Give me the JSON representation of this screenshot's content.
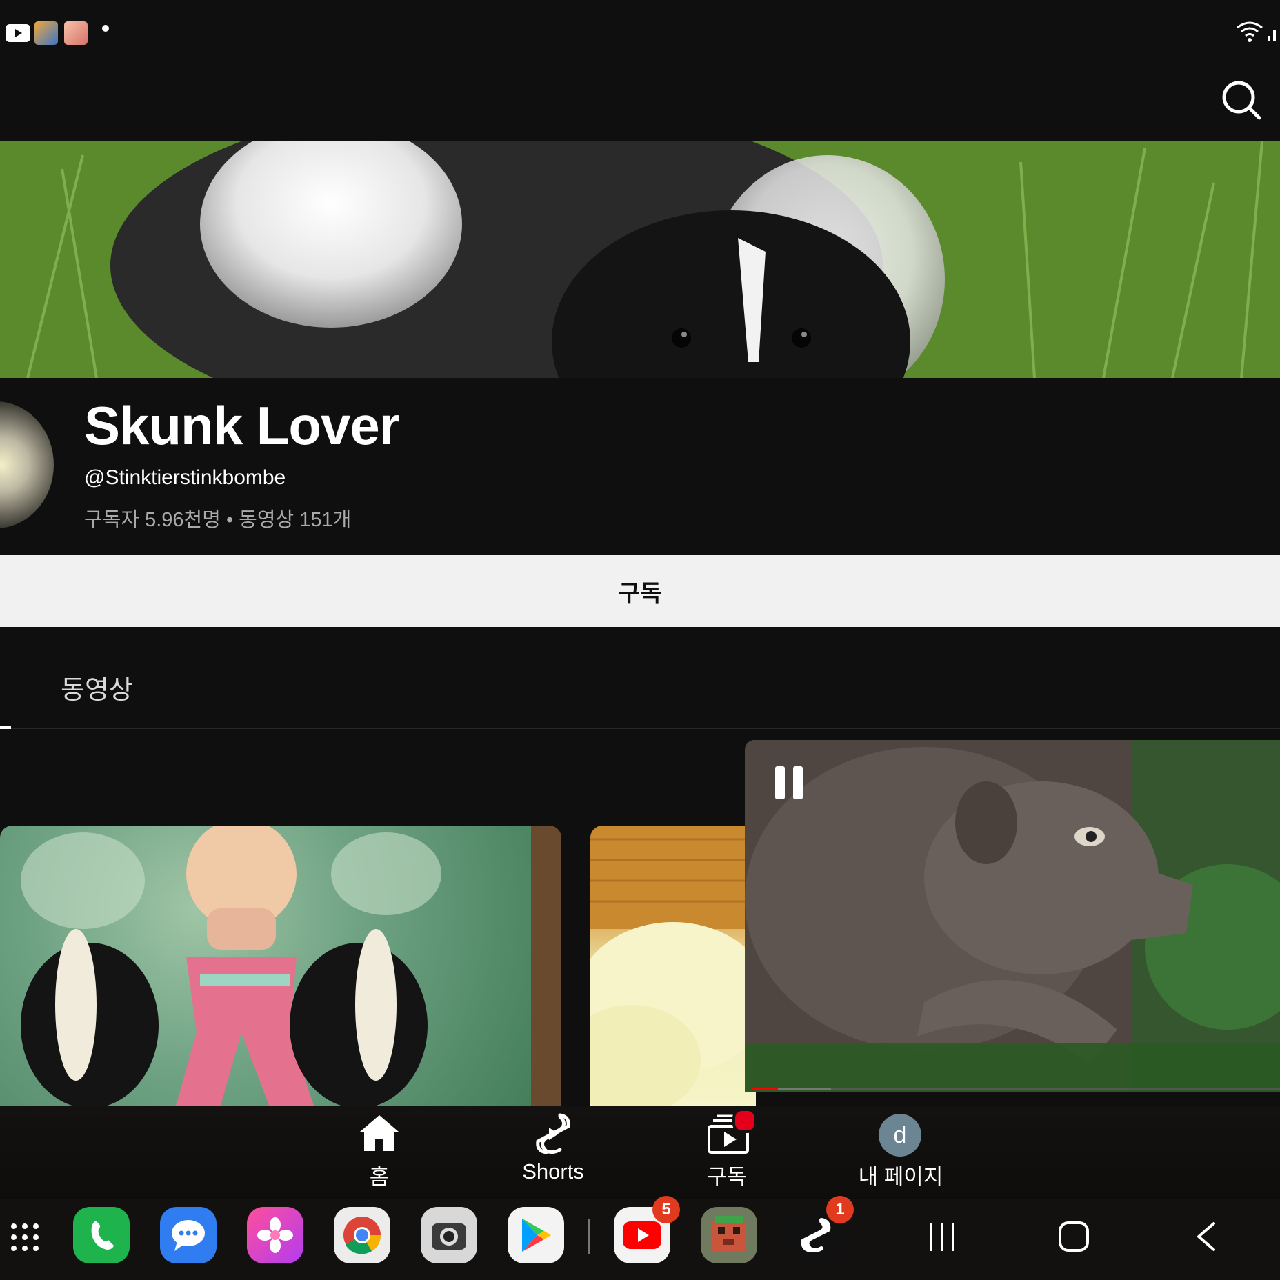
{
  "status_bar": {
    "notification_icons": [
      "youtube-notification-icon",
      "game-notification-icon-1",
      "game-notification-icon-2"
    ],
    "more_dot": "•"
  },
  "channel": {
    "name": "Skunk Lover",
    "handle": "@Stinktierstinkbombe",
    "stats": "구독자 5.96천명 • 동영상 151개",
    "subscribe_label": "구독"
  },
  "tabs": {
    "videos_label": "동영상"
  },
  "mini_player": {
    "state": "playing",
    "progress": 0.05,
    "buffered": 0.15
  },
  "bottom_nav": {
    "items": [
      {
        "label": "홈",
        "icon": "home-icon"
      },
      {
        "label": "Shorts",
        "icon": "shorts-icon"
      },
      {
        "label": "구독",
        "icon": "subscriptions-icon"
      },
      {
        "label": "내 페이지",
        "icon": "avatar-icon",
        "avatar_letter": "d"
      }
    ]
  },
  "dock": {
    "apps": [
      {
        "name": "phone",
        "icon": "phone-icon"
      },
      {
        "name": "messages",
        "icon": "messages-icon"
      },
      {
        "name": "gallery",
        "icon": "gallery-icon"
      },
      {
        "name": "chrome",
        "icon": "chrome-icon"
      },
      {
        "name": "camera",
        "icon": "camera-icon"
      },
      {
        "name": "play-store",
        "icon": "play-store-icon"
      },
      {
        "name": "youtube",
        "icon": "youtube-icon",
        "badge": "5"
      },
      {
        "name": "game",
        "icon": "game-icon"
      },
      {
        "name": "shorts-app",
        "icon": "shorts-app-icon",
        "badge": "1"
      }
    ]
  },
  "colors": {
    "background": "#0f0f0f",
    "subscribe_bg": "#f1f1f1",
    "accent_red": "#ff0000",
    "badge_red": "#e23a1f"
  }
}
